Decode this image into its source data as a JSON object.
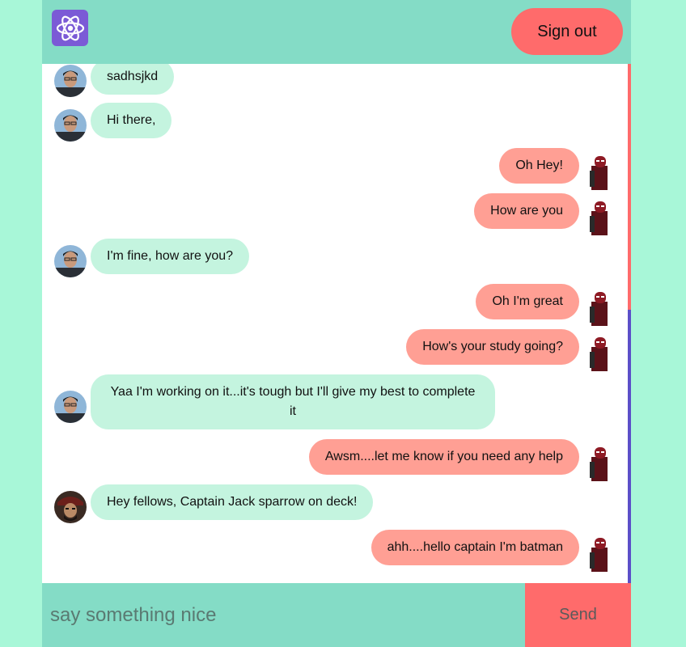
{
  "header": {
    "logo_icon": "atom-icon",
    "signout_label": "Sign out"
  },
  "colors": {
    "header_bg": "#84dcc6",
    "accent": "#ff6b6b",
    "received_bubble": "#c4f4df",
    "sent_bubble": "#ff9f94",
    "page_bg": "#a8f7d8"
  },
  "messages": [
    {
      "side": "received",
      "avatar": "user-avatar-glasses",
      "text": "sadhsjkd"
    },
    {
      "side": "received",
      "avatar": "user-avatar-glasses",
      "text": "Hi there,"
    },
    {
      "side": "sent",
      "avatar": "deadpool-avatar",
      "text": "Oh Hey!"
    },
    {
      "side": "sent",
      "avatar": "deadpool-avatar",
      "text": "How are you"
    },
    {
      "side": "received",
      "avatar": "user-avatar-glasses",
      "text": "I'm fine, how are you?"
    },
    {
      "side": "sent",
      "avatar": "deadpool-avatar",
      "text": "Oh I'm great"
    },
    {
      "side": "sent",
      "avatar": "deadpool-avatar",
      "text": "How's your study going?"
    },
    {
      "side": "received",
      "avatar": "user-avatar-glasses",
      "text": "Yaa I'm working on it...it's tough but I'll give my best to complete it"
    },
    {
      "side": "sent",
      "avatar": "deadpool-avatar",
      "text": "Awsm....let me know if you need any help"
    },
    {
      "side": "received",
      "avatar": "pirate-avatar",
      "text": "Hey fellows, Captain Jack sparrow on deck!"
    },
    {
      "side": "sent",
      "avatar": "deadpool-avatar",
      "text": "ahh....hello captain I'm batman"
    }
  ],
  "composer": {
    "placeholder": "say something nice",
    "value": "",
    "send_label": "Send"
  }
}
